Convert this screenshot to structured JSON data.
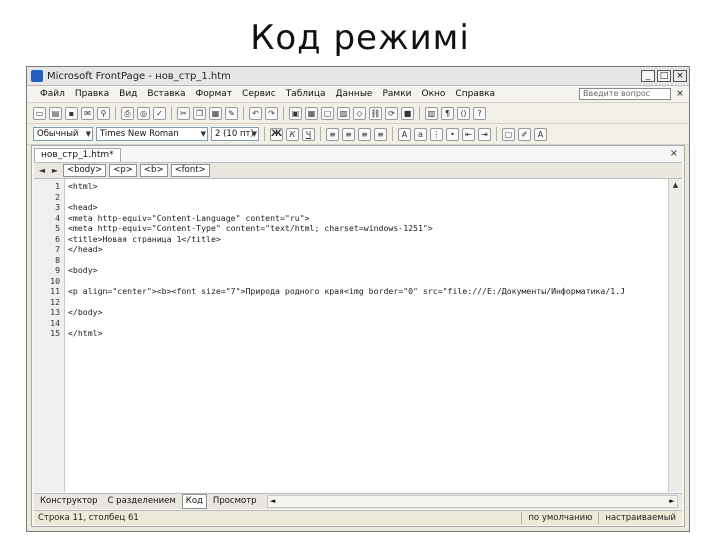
{
  "slide_title": "Код режимі",
  "window": {
    "title": "Microsoft FrontPage - нов_стр_1.htm",
    "min_label": "_",
    "max_label": "□",
    "close_label": "×"
  },
  "menu": {
    "items": [
      "Файл",
      "Правка",
      "Вид",
      "Вставка",
      "Формат",
      "Сервис",
      "Таблица",
      "Данные",
      "Рамки",
      "Окно",
      "Справка"
    ],
    "help_placeholder": "Введите вопрос",
    "close_label": "×"
  },
  "format_toolbar": {
    "style_value": "Обычный",
    "font_value": "Times New Roman",
    "size_value": "2 (10 пт)"
  },
  "document": {
    "tab_label": "нов_стр_1.htm*",
    "close_label": "×",
    "tags": [
      "<body>",
      "<p>",
      "<b>",
      "<font>"
    ]
  },
  "code_lines": [
    {
      "n": "1",
      "text": "<html>"
    },
    {
      "n": "2",
      "text": ""
    },
    {
      "n": "3",
      "text": "<head>"
    },
    {
      "n": "4",
      "text": "<meta http-equiv=\"Content-Language\" content=\"ru\">"
    },
    {
      "n": "5",
      "text": "<meta http-equiv=\"Content-Type\" content=\"text/html; charset=windows-1251\">"
    },
    {
      "n": "6",
      "text": "<title>Новая страница 1</title>"
    },
    {
      "n": "7",
      "text": "</head>"
    },
    {
      "n": "8",
      "text": ""
    },
    {
      "n": "9",
      "text": "<body>"
    },
    {
      "n": "10",
      "text": ""
    },
    {
      "n": "11",
      "text": "<p align=\"center\"><b><font size=\"7\">Природа родного края<img border=\"0\" src=\"file:///E:/Документы/Информатика/1.J"
    },
    {
      "n": "12",
      "text": ""
    },
    {
      "n": "13",
      "text": "</body>"
    },
    {
      "n": "14",
      "text": ""
    },
    {
      "n": "15",
      "text": "</html>"
    }
  ],
  "view_tabs": [
    "Конструктор",
    "С разделением",
    "Код",
    "Просмотр"
  ],
  "status": {
    "position": "Строка 11, столбец 61",
    "mode": "по умолчанию",
    "custom": "настраиваемый"
  }
}
